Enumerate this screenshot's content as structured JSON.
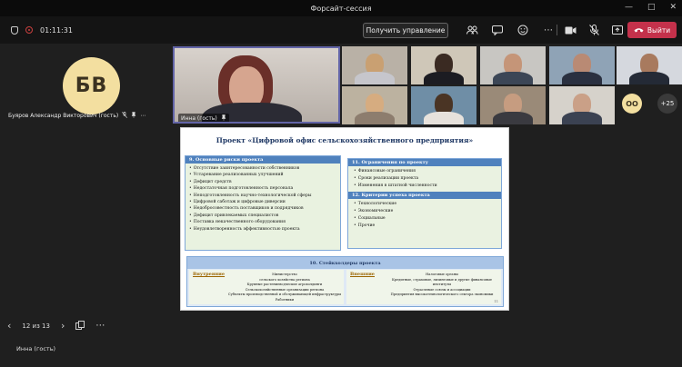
{
  "window": {
    "title": "Форсайт-сессия",
    "controls": [
      "—",
      "□",
      "✕"
    ]
  },
  "toolbar": {
    "timer": "01:11:31",
    "control_label": "Получить управление",
    "leave_label": "Выйти",
    "leave_color": "#c4314b"
  },
  "pinned": {
    "initials": "БВ",
    "name": "Буяров Александр Викторович (гость)"
  },
  "speaker": {
    "name": "Инна (гость)",
    "accent": "#6264a7"
  },
  "participants": {
    "avatar_initials": "OO",
    "overflow_count": "+25"
  },
  "slide": {
    "title": "Проект «Цифровой офис сельскохозяйственного предприятия»",
    "risks_heading": "9. Основные риски проекта",
    "risks": [
      "Отсутствие заинтересованности собственников",
      "Устаревание реализованных улучшений",
      "Дефицит средств",
      "Недостаточная подготовленность персонала",
      "Неподготовленность научно-технологической сферы",
      "Цифровой саботаж и цифровые диверсии",
      "Недобросовестность поставщиков и подрядчиков",
      "Дефицит привлекаемых специалистов",
      "Поставка некачественного оборудования",
      "Неудовлетворенность эффективностью проекта"
    ],
    "limits_heading": "11. Ограничения по проекту",
    "limits": [
      "Финансовые ограничения",
      "Сроки реализации проекта",
      "Изменения в штатной численности"
    ],
    "criteria_heading": "12. Критерии успеха проекта",
    "criteria": [
      "Технологические",
      "Экономические",
      "Социальные",
      "Прочие"
    ],
    "stake_heading": "10. Стейкхолдеры проекта",
    "internal_label": "Внутренние",
    "internal": [
      "Министерство",
      "сельского хозяйства региона",
      "Крупные растениеводческие агрохолдинги",
      "Сельскохозяйственные организации региона",
      "Субъекты производственной и обслуживающей инфраструктуры",
      "Работники"
    ],
    "external_label": "Внешние",
    "external": [
      "Налоговые органы",
      "Кредитные, страховые, лизинговые и другие финансовые",
      "институты",
      "Отраслевые союзы и ассоциации",
      "Предприятия высокотехнологического сектора экономики"
    ],
    "page_no": "11"
  },
  "pager": {
    "label": "12 из 13"
  },
  "bottom": {
    "name": "Инна (гость)"
  }
}
